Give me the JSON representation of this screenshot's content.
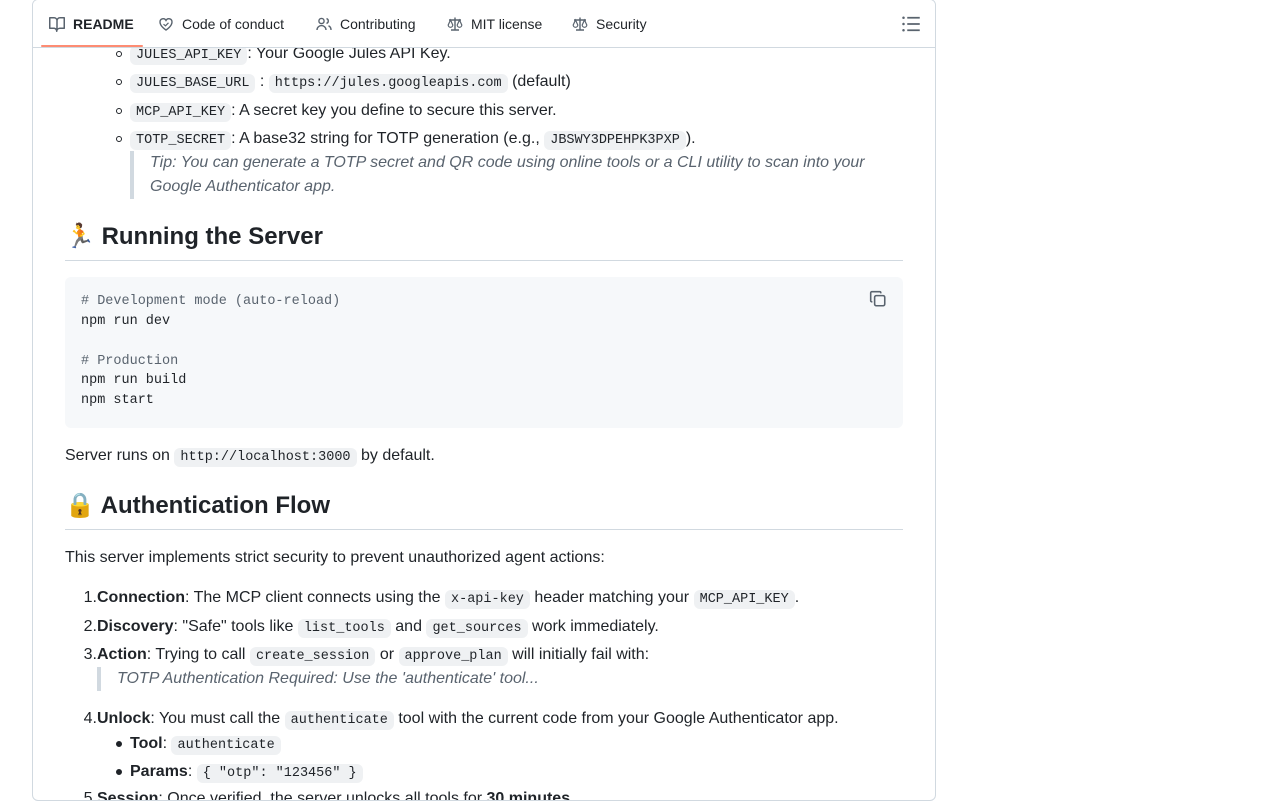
{
  "tabs": [
    {
      "label": "README",
      "icon": "book-icon",
      "active": true
    },
    {
      "label": "Code of conduct",
      "icon": "heart-icon",
      "active": false
    },
    {
      "label": "Contributing",
      "icon": "people-icon",
      "active": false
    },
    {
      "label": "MIT license",
      "icon": "law-icon",
      "active": false
    },
    {
      "label": "Security",
      "icon": "law-icon",
      "active": false
    }
  ],
  "env_vars": [
    {
      "name": "JULES_API_KEY",
      "desc": ": Your Google Jules API Key."
    },
    {
      "name": "JULES_BASE_URL",
      "sep": ":",
      "value": "https://jules.googleapis.com",
      "suffix": "(default)"
    },
    {
      "name": "MCP_API_KEY",
      "desc": ": A secret key you define to secure this server."
    },
    {
      "name": "TOTP_SECRET",
      "desc": ": A base32 string for TOTP generation (e.g.,",
      "example": "JBSWY3DPEHPK3PXP",
      "end": ")."
    }
  ],
  "tip": {
    "line1": "Tip: You can generate a TOTP secret and QR code using online tools or a CLI utility to scan into your",
    "line2": "Google Authenticator app."
  },
  "running": {
    "emoji": "🏃",
    "heading": "Running the Server",
    "code_lines": [
      {
        "text": "# Development mode (auto-reload)",
        "comment": true
      },
      {
        "text": "npm run dev",
        "comment": false
      },
      {
        "text": "",
        "comment": false
      },
      {
        "text": "# Production",
        "comment": true
      },
      {
        "text": "npm run build",
        "comment": false
      },
      {
        "text": "npm start",
        "comment": false
      }
    ],
    "server_prefix": "Server runs on",
    "server_url": "http://localhost:3000",
    "server_suffix": "by default."
  },
  "auth": {
    "emoji": "🔒",
    "heading": "Authentication Flow",
    "intro": "This server implements strict security to prevent unauthorized agent actions:",
    "steps": {
      "s1": {
        "num": "1.",
        "title": "Connection",
        "t1": ": The MCP client connects using the",
        "c1": "x-api-key",
        "t2": "header matching your",
        "c2": "MCP_API_KEY",
        "t3": "."
      },
      "s2": {
        "num": "2.",
        "title": "Discovery",
        "t1": ": \"Safe\" tools like",
        "c1": "list_tools",
        "t2": "and",
        "c2": "get_sources",
        "t3": "work immediately."
      },
      "s3": {
        "num": "3.",
        "title": "Action",
        "t1": ": Trying to call",
        "c1": "create_session",
        "t2": "or",
        "c2": "approve_plan",
        "t3": "will initially fail with:"
      },
      "s3_quote": "TOTP Authentication Required: Use the 'authenticate' tool...",
      "s4": {
        "num": "4.",
        "title": "Unlock",
        "t1": ": You must call the",
        "c1": "authenticate",
        "t2": "tool with the current code from your Google Authenticator app."
      },
      "s4_sub": [
        {
          "label": "Tool",
          "sep": ":",
          "code": "authenticate"
        },
        {
          "label": "Params",
          "sep": ":",
          "code": "{ \"otp\": \"123456\" }"
        }
      ],
      "s5": {
        "num": "5.",
        "title": "Session",
        "t1": ": Once verified, the server unlocks all tools for",
        "bold": "30 minutes",
        "t2": "."
      }
    }
  }
}
